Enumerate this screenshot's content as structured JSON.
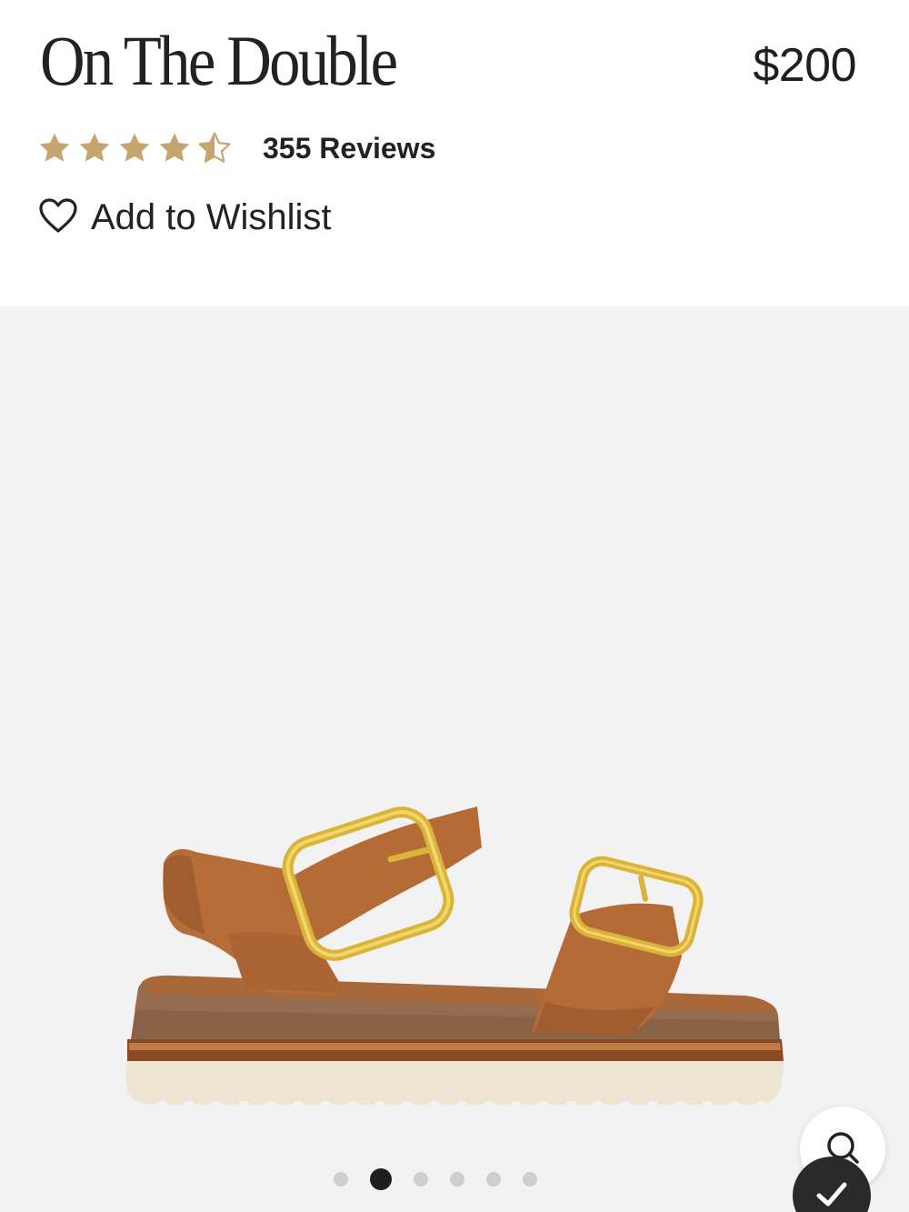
{
  "product": {
    "title": "On The Double",
    "price": "$200"
  },
  "rating": {
    "value": 4.5,
    "max": 5,
    "star_color": "#c6a46e",
    "reviews_label": "355 Reviews"
  },
  "wishlist": {
    "label": "Add to Wishlist",
    "icon": "heart-outline-icon"
  },
  "gallery": {
    "image_alt": "Tan leather sandal with gold buckles",
    "slide_count": 6,
    "active_slide": 2,
    "background": "#f3f2f2"
  },
  "floating_buttons": {
    "search_icon": "search-icon",
    "check_icon": "check-icon"
  }
}
